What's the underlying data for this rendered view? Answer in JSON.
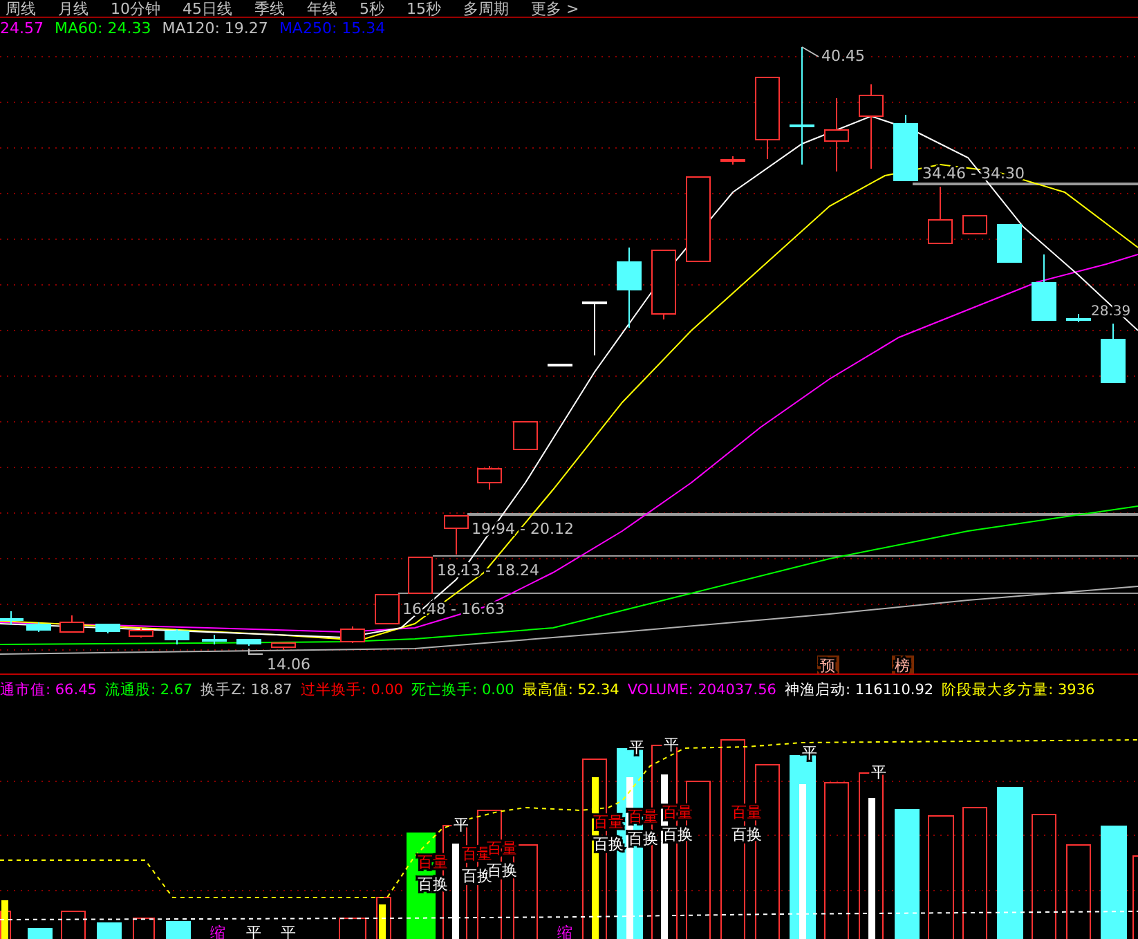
{
  "tabs": [
    {
      "label": "周线"
    },
    {
      "label": "月线"
    },
    {
      "label": "10分钟"
    },
    {
      "label": "45日线"
    },
    {
      "label": "季线"
    },
    {
      "label": "年线"
    },
    {
      "label": "5秒"
    },
    {
      "label": "15秒"
    },
    {
      "label": "多周期"
    },
    {
      "label": "更多 >"
    }
  ],
  "ma_legend": [
    {
      "label": "24.57",
      "color": "#ff00ff"
    },
    {
      "label": "MA60: 24.33",
      "color": "#00ff00"
    },
    {
      "label": "MA120: 19.27",
      "color": "#c0c0c0"
    },
    {
      "label": "MA250: 15.34",
      "color": "#0000ff"
    }
  ],
  "price_chart": {
    "price_labels": [
      {
        "text": "40.45"
      },
      {
        "text": "34.46 - 34.30"
      },
      {
        "text": "28.39"
      },
      {
        "text": "19.94 - 20.12"
      },
      {
        "text": "18.13 - 18.24"
      },
      {
        "text": "16.48 - 16.63"
      },
      {
        "text": "14.06"
      }
    ],
    "tags": [
      "预",
      "榜"
    ]
  },
  "indicator_legend": [
    {
      "label": "通市值: 66.45",
      "color": "#ff00ff"
    },
    {
      "label": "流通股: 2.67",
      "color": "#00ff00"
    },
    {
      "label": "换手Z: 18.87",
      "color": "#c0c0c0"
    },
    {
      "label": "过半换手: 0.00",
      "color": "#ff0000"
    },
    {
      "label": "死亡换手: 0.00",
      "color": "#00ff00"
    },
    {
      "label": "最高值: 52.34",
      "color": "#ffff00"
    },
    {
      "label": "VOLUME: 204037.56",
      "color": "#ff00ff"
    },
    {
      "label": "神渔启动: 116110.92",
      "color": "#ffffff"
    },
    {
      "label": "阶段最大多方量: 3936",
      "color": "#ffff00"
    }
  ],
  "volume_marks": [
    {
      "text": "百量",
      "kind": "volume"
    },
    {
      "text": "百换",
      "kind": "turnover"
    },
    {
      "text": "百量",
      "kind": "volume"
    },
    {
      "text": "百换",
      "kind": "turnover"
    },
    {
      "text": "百量",
      "kind": "volume"
    },
    {
      "text": "百换",
      "kind": "turnover"
    },
    {
      "text": "百量",
      "kind": "volume"
    },
    {
      "text": "百换",
      "kind": "turnover"
    },
    {
      "text": "百量",
      "kind": "volume"
    },
    {
      "text": "百换",
      "kind": "turnover"
    },
    {
      "text": "百量",
      "kind": "volume"
    },
    {
      "text": "百换",
      "kind": "turnover"
    },
    {
      "text": "百量",
      "kind": "volume"
    },
    {
      "text": "百换",
      "kind": "turnover"
    },
    {
      "text": "缩",
      "kind": "shrink"
    },
    {
      "text": "平",
      "kind": "flat"
    },
    {
      "text": "平",
      "kind": "flat"
    },
    {
      "text": "平",
      "kind": "flat"
    },
    {
      "text": "缩",
      "kind": "shrink"
    },
    {
      "text": "平",
      "kind": "flat"
    },
    {
      "text": "平",
      "kind": "flat"
    },
    {
      "text": "平",
      "kind": "flat"
    },
    {
      "text": "平",
      "kind": "flat"
    }
  ]
}
